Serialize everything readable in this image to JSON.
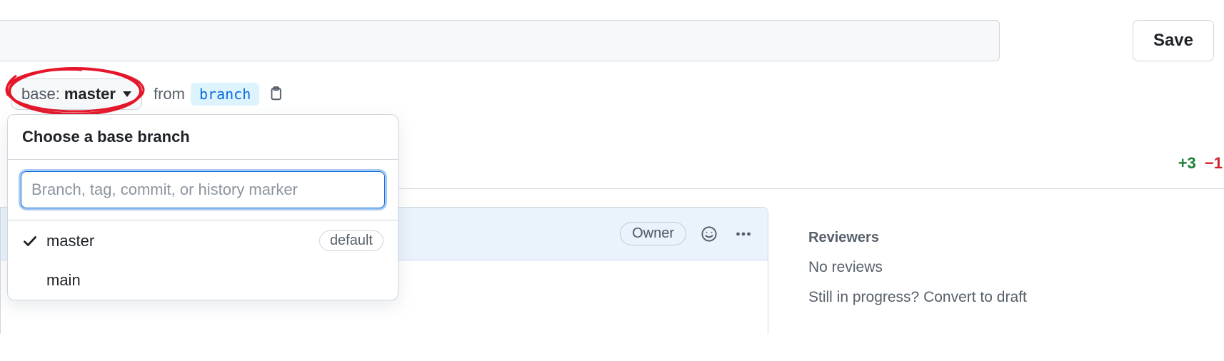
{
  "toolbar": {
    "save_label": "Save"
  },
  "branchbar": {
    "base_prefix": "base: ",
    "base_value": "master",
    "from_text": "from",
    "compare_label": "branch"
  },
  "popover": {
    "title": "Choose a base branch",
    "search_placeholder": "Branch, tag, commit, or history marker",
    "items": [
      {
        "name": "master",
        "selected": true,
        "default": true
      },
      {
        "name": "main",
        "selected": false,
        "default": false
      }
    ],
    "default_badge": "default"
  },
  "diff": {
    "additions": "+3",
    "deletions": "−1"
  },
  "comment": {
    "owner_badge": "Owner"
  },
  "sidebar": {
    "reviewers_heading": "Reviewers",
    "no_reviews": "No reviews",
    "draft_prompt": "Still in progress? Convert to draft"
  }
}
